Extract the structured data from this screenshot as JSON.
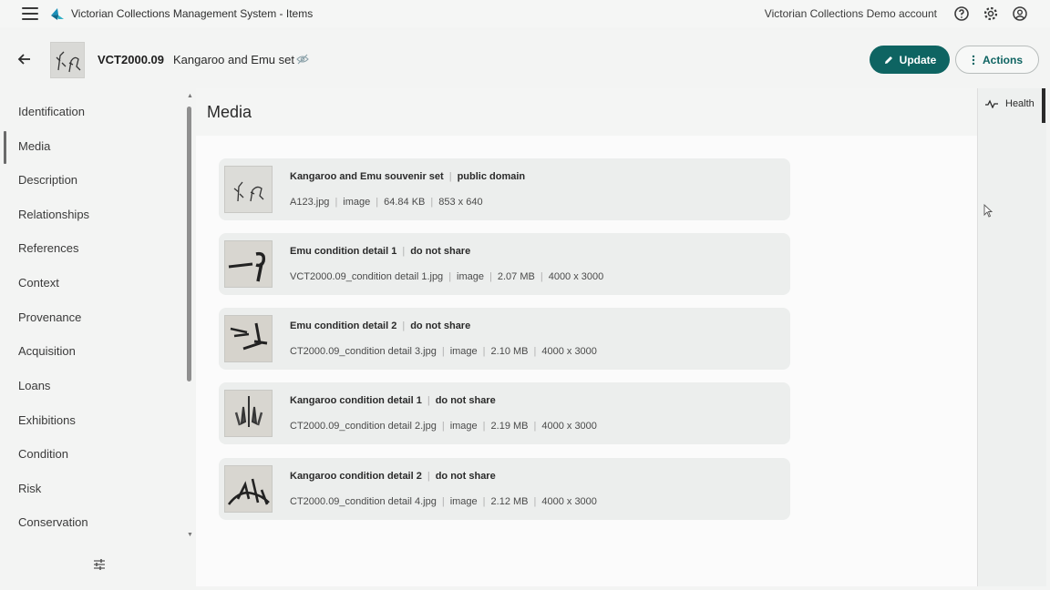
{
  "topbar": {
    "app_title": "Victorian Collections Management System - Items",
    "account": "Victorian Collections Demo account",
    "icons": [
      "menu-icon",
      "help-icon",
      "settings-icon",
      "account-icon"
    ]
  },
  "header": {
    "record_id": "VCT2000.09",
    "record_name": "Kangaroo and Emu set",
    "update_label": "Update",
    "actions_label": "Actions"
  },
  "sidebar": {
    "items": [
      {
        "label": "Identification"
      },
      {
        "label": "Media"
      },
      {
        "label": "Description"
      },
      {
        "label": "Relationships"
      },
      {
        "label": "References"
      },
      {
        "label": "Context"
      },
      {
        "label": "Provenance"
      },
      {
        "label": "Acquisition"
      },
      {
        "label": "Loans"
      },
      {
        "label": "Exhibitions"
      },
      {
        "label": "Condition"
      },
      {
        "label": "Risk"
      },
      {
        "label": "Conservation"
      }
    ],
    "active": "Media"
  },
  "main": {
    "title": "Media",
    "media": [
      {
        "title": "Kangaroo and Emu souvenir set",
        "rights": "public domain",
        "file": "A123.jpg",
        "type": "image",
        "size": "64.84 KB",
        "dims": "853 x 640"
      },
      {
        "title": "Emu condition detail 1",
        "rights": "do not share",
        "file": "VCT2000.09_condition detail 1.jpg",
        "type": "image",
        "size": "2.07 MB",
        "dims": "4000 x 3000"
      },
      {
        "title": "Emu condition detail 2",
        "rights": "do not share",
        "file": "CT2000.09_condition detail 3.jpg",
        "type": "image",
        "size": "2.10 MB",
        "dims": "4000 x 3000"
      },
      {
        "title": "Kangaroo condition detail 1",
        "rights": "do not share",
        "file": "CT2000.09_condition detail 2.jpg",
        "type": "image",
        "size": "2.19 MB",
        "dims": "4000 x 3000"
      },
      {
        "title": "Kangaroo condition detail 2",
        "rights": "do not share",
        "file": "CT2000.09_condition detail 4.jpg",
        "type": "image",
        "size": "2.12 MB",
        "dims": "4000 x 3000"
      }
    ]
  },
  "rightpanel": {
    "health_label": "Health"
  },
  "colors": {
    "accent": "#0e6462",
    "background": "#f3f4f3",
    "card": "#eceeed"
  }
}
